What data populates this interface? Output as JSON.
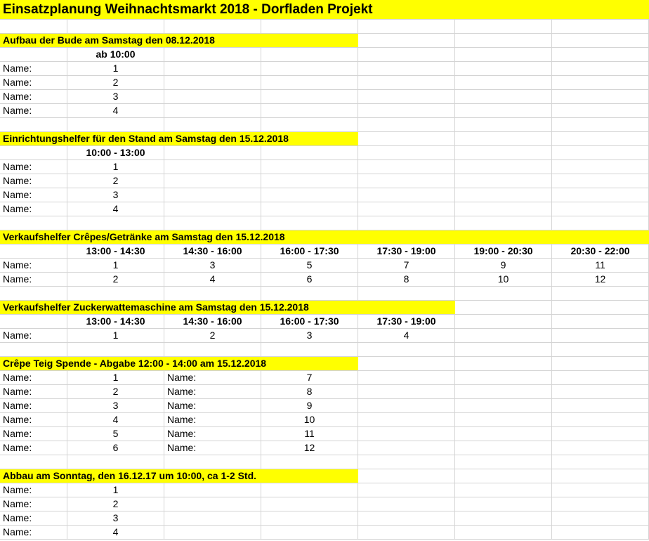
{
  "title": "Einsatzplanung Weihnachtsmarkt 2018 - Dorfladen Projekt",
  "colors": {
    "highlight": "#ffff00",
    "gridline": "#d4d4d4"
  },
  "name_label": "Name:",
  "sections": [
    {
      "heading": "Aufbau der Bude am Samstag den 08.12.2018",
      "highlight_cols": 4,
      "column_headers": [
        "ab 10:00"
      ],
      "rows": [
        {
          "label": "Name:",
          "cells": [
            "1"
          ]
        },
        {
          "label": "Name:",
          "cells": [
            "2"
          ]
        },
        {
          "label": "Name:",
          "cells": [
            "3"
          ]
        },
        {
          "label": "Name:",
          "cells": [
            "4"
          ]
        }
      ]
    },
    {
      "heading": "Einrichtungshelfer für den Stand am Samstag den 15.12.2018",
      "highlight_cols": 4,
      "column_headers": [
        "10:00 - 13:00"
      ],
      "rows": [
        {
          "label": "Name:",
          "cells": [
            "1"
          ]
        },
        {
          "label": "Name:",
          "cells": [
            "2"
          ]
        },
        {
          "label": "Name:",
          "cells": [
            "3"
          ]
        },
        {
          "label": "Name:",
          "cells": [
            "4"
          ]
        }
      ]
    },
    {
      "heading": "Verkaufshelfer Crêpes/Getränke am Samstag den 15.12.2018",
      "highlight_cols": 7,
      "column_headers": [
        "13:00 - 14:30",
        "14:30 - 16:00",
        "16:00 - 17:30",
        "17:30 - 19:00",
        "19:00 - 20:30",
        "20:30 - 22:00"
      ],
      "rows": [
        {
          "label": "Name:",
          "cells": [
            "1",
            "3",
            "5",
            "7",
            "9",
            "11"
          ]
        },
        {
          "label": "Name:",
          "cells": [
            "2",
            "4",
            "6",
            "8",
            "10",
            "12"
          ]
        }
      ]
    },
    {
      "heading": "Verkaufshelfer Zuckerwattemaschine am Samstag den 15.12.2018",
      "highlight_cols": 5,
      "column_headers": [
        "13:00 - 14:30",
        "14:30 - 16:00",
        "16:00 - 17:30",
        "17:30 - 19:00"
      ],
      "rows": [
        {
          "label": "Name:",
          "cells": [
            "1",
            "2",
            "3",
            "4"
          ]
        }
      ]
    },
    {
      "heading": "Crêpe Teig Spende - Abgabe 12:00 - 14:00 am 15.12.2018",
      "highlight_cols": 4,
      "column_headers": [],
      "paired": true,
      "rows": [
        {
          "label": "Name:",
          "cells": [
            "1"
          ],
          "label2": "Name:",
          "cells2": [
            "7"
          ]
        },
        {
          "label": "Name:",
          "cells": [
            "2"
          ],
          "label2": "Name:",
          "cells2": [
            "8"
          ]
        },
        {
          "label": "Name:",
          "cells": [
            "3"
          ],
          "label2": "Name:",
          "cells2": [
            "9"
          ]
        },
        {
          "label": "Name:",
          "cells": [
            "4"
          ],
          "label2": "Name:",
          "cells2": [
            "10"
          ]
        },
        {
          "label": "Name:",
          "cells": [
            "5"
          ],
          "label2": "Name:",
          "cells2": [
            "11"
          ]
        },
        {
          "label": "Name:",
          "cells": [
            "6"
          ],
          "label2": "Name:",
          "cells2": [
            "12"
          ]
        }
      ]
    },
    {
      "heading": "Abbau am Sonntag, den 16.12.17 um 10:00, ca 1-2 Std.",
      "highlight_cols": 4,
      "column_headers": [],
      "rows": [
        {
          "label": "Name:",
          "cells": [
            "1"
          ]
        },
        {
          "label": "Name:",
          "cells": [
            "2"
          ]
        },
        {
          "label": "Name:",
          "cells": [
            "3"
          ]
        },
        {
          "label": "Name:",
          "cells": [
            "4"
          ]
        }
      ]
    }
  ]
}
